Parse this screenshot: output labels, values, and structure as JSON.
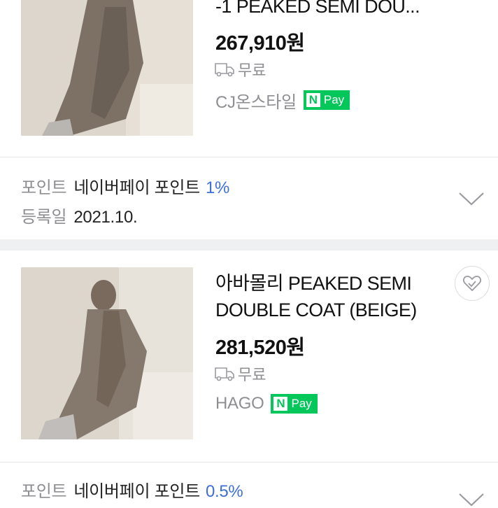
{
  "product1": {
    "title": "-1 PEAKED SEMI DOU...",
    "price": "267,910원",
    "shipping": "무료",
    "seller": "CJ온스타일",
    "npay": {
      "n": "N",
      "pay": "Pay"
    },
    "point_label": "포인트",
    "point_text": "네이버페이 포인트",
    "point_rate": "1%",
    "reg_label": "등록일",
    "reg_date": "2021.10."
  },
  "product2": {
    "title": "아바몰리 PEAKED SEMI DOUBLE COAT (BEIGE)",
    "price": "281,520원",
    "shipping": "무료",
    "seller": "HAGO",
    "npay": {
      "n": "N",
      "pay": "Pay"
    },
    "point_label": "포인트",
    "point_text": "네이버페이 포인트",
    "point_rate": "0.5%"
  },
  "colors": {
    "npay_green": "#03c75a",
    "accent_blue": "#3e6fd8",
    "muted_gray": "#8e8e93"
  },
  "icons": [
    "truck-icon",
    "chevron-down-icon",
    "heart-icon"
  ]
}
